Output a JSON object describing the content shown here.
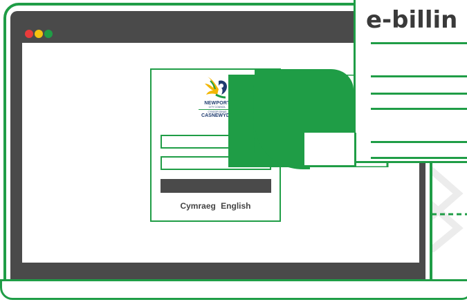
{
  "browser": {
    "traffic_lights": [
      "red-dot",
      "yellow-dot",
      "green-dot"
    ]
  },
  "login": {
    "logo": {
      "name": "NEWPORT",
      "sub": "CITY COUNCIL",
      "welsh_sub": "CYNGOR DINAS",
      "welsh_name": "CASNEWYDD"
    },
    "language_links": [
      "Cymraeg",
      "English"
    ]
  },
  "ebilling": {
    "title": "e-billin"
  },
  "colors": {
    "accent": "#1f9d46",
    "dark": "#4a4a4a",
    "text": "#3a3a3a",
    "logo_blue": "#1d3b6f",
    "logo_gold": "#f2b705"
  }
}
